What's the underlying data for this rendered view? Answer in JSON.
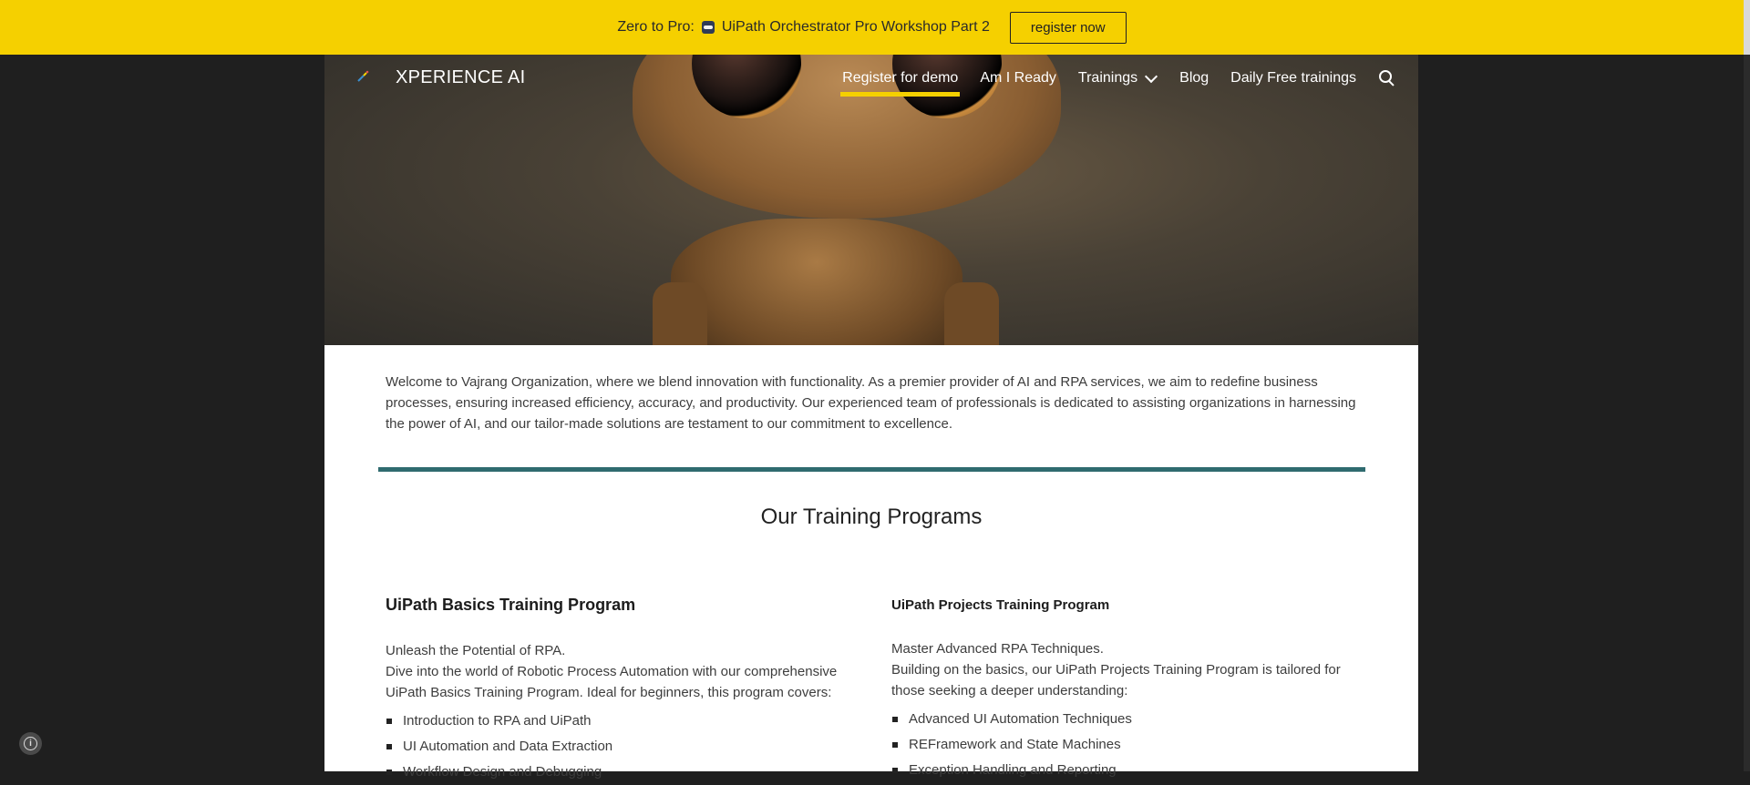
{
  "banner": {
    "text": "Zero to Pro: ",
    "emoji_icon": "sunglasses-emoji",
    "text_after": "UiPath Orchestrator Pro Workshop Part 2",
    "button_label": "register now",
    "bg_color": "#f5d000"
  },
  "header": {
    "site_title": "XPERIENCE AI",
    "nav": [
      {
        "label": "Register for demo"
      },
      {
        "label": "Am I Ready"
      },
      {
        "label": "Trainings"
      },
      {
        "label": "Blog"
      },
      {
        "label": "Daily Free trainings"
      }
    ],
    "active_color": "#f5d000"
  },
  "main": {
    "intro": "Welcome to Vajrang Organization, where we blend innovation with functionality. As a premier provider of AI and RPA services, we aim to redefine business processes, ensuring increased efficiency, accuracy, and productivity. Our experienced team of professionals is dedicated to assisting organizations in harnessing the power of AI, and our tailor-made solutions are testament to our commitment to excellence.",
    "section_title": "Our Training Programs",
    "divider_color": "#2f6b6f",
    "programs": [
      {
        "title": "UiPath Basics Training Program",
        "tagline": "Unleash the Potential of RPA.",
        "description": "Dive into the world of Robotic Process Automation with our comprehensive UiPath Basics Training Program. Ideal for beginners, this program covers:",
        "items": [
          "Introduction to RPA and UiPath",
          "UI Automation and Data Extraction",
          "Workflow Design and Debugging"
        ]
      },
      {
        "title": "UiPath Projects Training Program",
        "tagline": "Master Advanced RPA Techniques.",
        "description": "Building on the basics, our UiPath Projects Training Program is tailored for those seeking a deeper understanding:",
        "items": [
          "Advanced UI Automation Techniques",
          "REFramework and State Machines",
          "Exception Handling and Reporting"
        ]
      }
    ]
  }
}
